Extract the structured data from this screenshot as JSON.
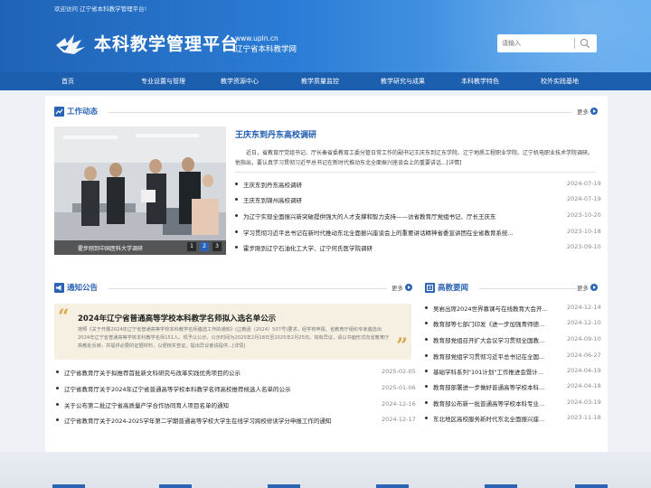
{
  "header": {
    "welcome": "欢迎访问 辽宁省本科教学管理平台!",
    "title": "本科教学管理平台",
    "url": "www.upln.cn",
    "subtitle": "辽宁省本科教学网",
    "search_placeholder": "请输入"
  },
  "nav": {
    "items": [
      "首页",
      "专业设置与管理",
      "教学资源中心",
      "教学质量监控",
      "教学研究与成果",
      "本科教学特色",
      "校外实践基地"
    ]
  },
  "work": {
    "title": "工作动态",
    "more": "更多",
    "photo_caption": "霍步刚到中国医科大学调研",
    "pages": [
      "1",
      "2",
      "3"
    ],
    "active_page": 2,
    "feature_title": "王庆东到丹东高校调研",
    "feature_desc": "近日，省教育厅党组书记、厅长秦省委教育工委分管日常工作的副书记王庆东到辽东学院、辽宁地质工程职业学院、辽宁机电职业技术学院调研。他指出，要认真学习贯彻习近平总书记在新时代推动东北全面振兴座谈会上的重要讲话...[详情]",
    "items": [
      {
        "text": "王庆东到丹东高校调研",
        "date": "2024-07-19"
      },
      {
        "text": "王庆东到锦州高校调研",
        "date": "2024-07-19"
      },
      {
        "text": "为辽宁实现全面振兴新突破提供强大的人才支撑和智力支持——访省教育厅党组书记、厅长王庆东",
        "date": "2023-10-20"
      },
      {
        "text": "学习贯彻习近平总书记在新时代推动东北全面振兴座谈会上的重要讲话精神省委宣讲团在全省教育系统...",
        "date": "2023-10-18"
      },
      {
        "text": "霍步刚到辽宁石油化工大学、辽宁何氏医学院调研",
        "date": "2023-09-10"
      }
    ]
  },
  "notice": {
    "title": "通知公告",
    "more": "更多",
    "card_title": "2024年辽宁省普通高等学校本科教学名师拟入选名单公示",
    "card_desc": "按照《关于开展2024年辽宁省普通高等学校本科教学名师遴选工作的通知》(辽教函〔2024〕507号)要求，经学校申报、省教育厅组织专家遴选出2024年辽宁省普通高等学校本科教学名师151人。现予以公示。公示时间为2025年2月18日至2025年2月25日。如有异议，请以书面形式向省教育厅高教处反映，并提供必要的证据材料，以便核实查证。提出异议者请提供...[详情]",
    "items": [
      {
        "text": "辽宁省教育厅关于拟推荐首批新文科研究与改革实践优秀项目的公示",
        "date": "2025-02-05"
      },
      {
        "text": "辽宁省教育厅关于2024年辽宁省普通高等学校本科教学名师高校推荐候选人名单的公示",
        "date": "2025-01-06"
      },
      {
        "text": "关于公布第二批辽宁省高质量产学合作协同育人项目名单的通知",
        "date": "2024-12-16"
      },
      {
        "text": "辽宁省教育厅关于2024-2025学年第二学期普通高等学校大学生在线学习跨校修读学分申报工作的通知",
        "date": "2024-12-17"
      }
    ]
  },
  "news": {
    "title": "高教要闻",
    "more": "更多",
    "items": [
      {
        "text": "吴岩出席2024世界慕课与在线教育大会开...",
        "date": "2024-12-14"
      },
      {
        "text": "教育部等七部门印发《进一步加强青师德...",
        "date": "2024-12-10"
      },
      {
        "text": "教育部党组召开扩大会议学习贯彻全国教...",
        "date": "2024-09-10"
      },
      {
        "text": "教育部党组学习贯彻习近平总书记在全国...",
        "date": "2024-06-27"
      },
      {
        "text": "基础学科系列\"101计划\"工作推进会暨计...",
        "date": "2024-04-19"
      },
      {
        "text": "教育部部署进一步做好普通高等学校本科...",
        "date": "2024-04-18"
      },
      {
        "text": "教育部公布新一批普通高等学校本科专业...",
        "date": "2024-03-19"
      },
      {
        "text": "东北地区高校服务新时代东北全面振兴座...",
        "date": "2023-11-18"
      }
    ]
  },
  "colors": {
    "brand_blue": "#1c5fae",
    "accent_gold": "#d8a84b"
  }
}
